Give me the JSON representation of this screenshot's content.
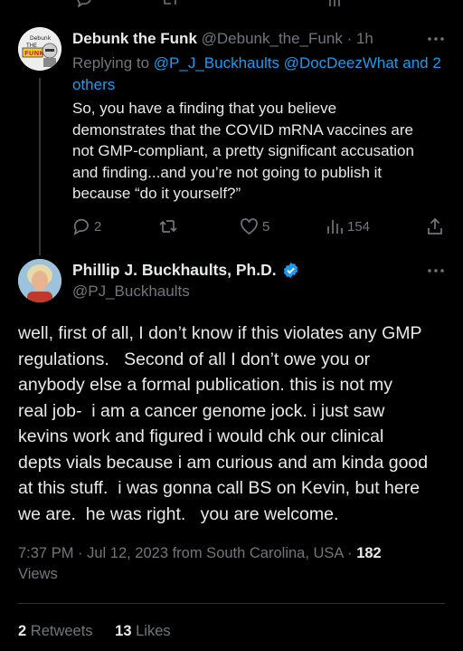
{
  "top_bar": {
    "icons": [
      "reply-icon",
      "retweet-icon",
      "like-icon",
      "views-icon"
    ]
  },
  "reply": {
    "author_name": "Debunk the Funk",
    "handle": "@Debunk_the_Funk",
    "time": "· 1h",
    "replying_prefix": "Replying to",
    "replying_targets": "@P_J_Buckhaults @DocDeezWhat and 2 others",
    "text_lines": [
      "So, you have a finding that you believe",
      "demonstrates that the COVID mRNA vaccines are",
      "not GMP-compliant, a pretty significant accusation",
      "and finding...and you’re not going to publish it",
      "because “do it yourself?”"
    ],
    "avatar_text": "Debunk the Funk",
    "actions": {
      "replies": "2",
      "retweets": "",
      "likes": "5",
      "views": "154"
    }
  },
  "main": {
    "author_name": "Phillip J. Buckhaults, Ph.D.",
    "handle": "@PJ_Buckhaults",
    "verified": true,
    "text_lines": [
      "well, first of all, I don’t know if this violates any GMP",
      "regulations.   Second of all I don’t owe you or",
      "anybody else a formal publication. this is not my",
      "real job-  i am a cancer genome jock. i just saw",
      "kevins work and figured i would chk our clinical",
      "depts vials because i am curious and am kinda good",
      "at this stuff.  i was gonna call BS on Kevin, but here",
      "we are.  he was right.   you are welcome."
    ],
    "meta_line1": "7:37 PM · Jul 12, 2023 from South Carolina, USA ·",
    "views_count": "182",
    "views_label": "Views",
    "retweets_count": "2",
    "retweets_label": "Retweets",
    "likes_count": "13",
    "likes_label": "Likes"
  },
  "colors": {
    "background": "#000000",
    "text": "#e7e9ea",
    "muted": "#71767b",
    "link": "#1d9bf0",
    "verified": "#1d9bf0",
    "divider": "#2f3336"
  }
}
